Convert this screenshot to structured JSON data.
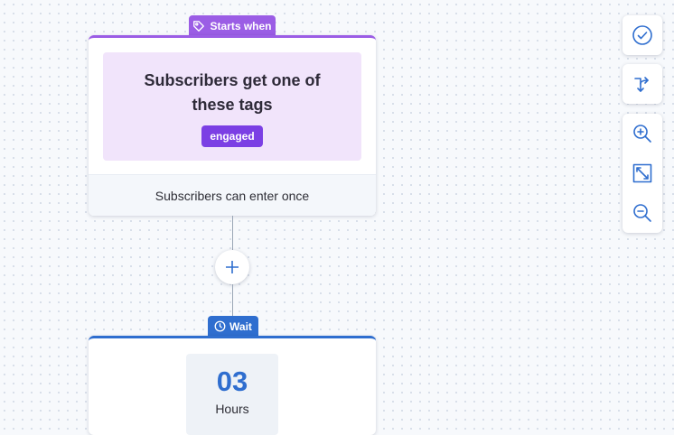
{
  "trigger": {
    "badge_label": "Starts when",
    "title": "Subscribers get one of these tags",
    "tag": "engaged",
    "footer": "Subscribers can enter once",
    "accent_color": "#9b5de5"
  },
  "connector": {
    "add_icon": "plus-icon"
  },
  "wait": {
    "badge_label": "Wait",
    "amount": "03",
    "unit": "Hours",
    "accent_color": "#2f6ecf"
  },
  "toolbar": {
    "icons": [
      "check-circle-icon",
      "branch-icon",
      "zoom-in-icon",
      "fit-screen-icon",
      "zoom-out-icon"
    ]
  }
}
